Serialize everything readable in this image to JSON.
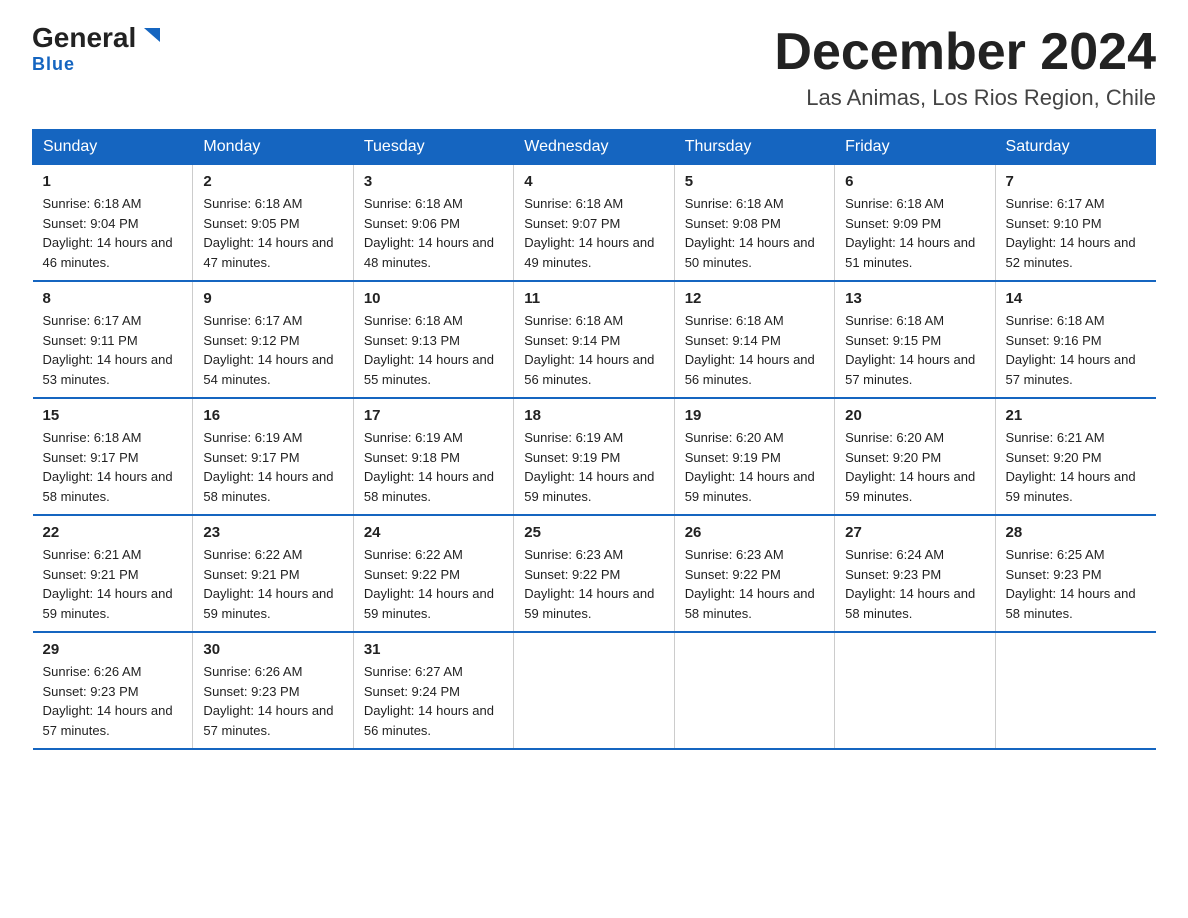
{
  "logo": {
    "general": "General",
    "blue": "Blue",
    "arrow": "▶"
  },
  "title": "December 2024",
  "subtitle": "Las Animas, Los Rios Region, Chile",
  "weekdays": [
    "Sunday",
    "Monday",
    "Tuesday",
    "Wednesday",
    "Thursday",
    "Friday",
    "Saturday"
  ],
  "weeks": [
    [
      {
        "day": "1",
        "sunrise": "6:18 AM",
        "sunset": "9:04 PM",
        "daylight": "14 hours and 46 minutes."
      },
      {
        "day": "2",
        "sunrise": "6:18 AM",
        "sunset": "9:05 PM",
        "daylight": "14 hours and 47 minutes."
      },
      {
        "day": "3",
        "sunrise": "6:18 AM",
        "sunset": "9:06 PM",
        "daylight": "14 hours and 48 minutes."
      },
      {
        "day": "4",
        "sunrise": "6:18 AM",
        "sunset": "9:07 PM",
        "daylight": "14 hours and 49 minutes."
      },
      {
        "day": "5",
        "sunrise": "6:18 AM",
        "sunset": "9:08 PM",
        "daylight": "14 hours and 50 minutes."
      },
      {
        "day": "6",
        "sunrise": "6:18 AM",
        "sunset": "9:09 PM",
        "daylight": "14 hours and 51 minutes."
      },
      {
        "day": "7",
        "sunrise": "6:17 AM",
        "sunset": "9:10 PM",
        "daylight": "14 hours and 52 minutes."
      }
    ],
    [
      {
        "day": "8",
        "sunrise": "6:17 AM",
        "sunset": "9:11 PM",
        "daylight": "14 hours and 53 minutes."
      },
      {
        "day": "9",
        "sunrise": "6:17 AM",
        "sunset": "9:12 PM",
        "daylight": "14 hours and 54 minutes."
      },
      {
        "day": "10",
        "sunrise": "6:18 AM",
        "sunset": "9:13 PM",
        "daylight": "14 hours and 55 minutes."
      },
      {
        "day": "11",
        "sunrise": "6:18 AM",
        "sunset": "9:14 PM",
        "daylight": "14 hours and 56 minutes."
      },
      {
        "day": "12",
        "sunrise": "6:18 AM",
        "sunset": "9:14 PM",
        "daylight": "14 hours and 56 minutes."
      },
      {
        "day": "13",
        "sunrise": "6:18 AM",
        "sunset": "9:15 PM",
        "daylight": "14 hours and 57 minutes."
      },
      {
        "day": "14",
        "sunrise": "6:18 AM",
        "sunset": "9:16 PM",
        "daylight": "14 hours and 57 minutes."
      }
    ],
    [
      {
        "day": "15",
        "sunrise": "6:18 AM",
        "sunset": "9:17 PM",
        "daylight": "14 hours and 58 minutes."
      },
      {
        "day": "16",
        "sunrise": "6:19 AM",
        "sunset": "9:17 PM",
        "daylight": "14 hours and 58 minutes."
      },
      {
        "day": "17",
        "sunrise": "6:19 AM",
        "sunset": "9:18 PM",
        "daylight": "14 hours and 58 minutes."
      },
      {
        "day": "18",
        "sunrise": "6:19 AM",
        "sunset": "9:19 PM",
        "daylight": "14 hours and 59 minutes."
      },
      {
        "day": "19",
        "sunrise": "6:20 AM",
        "sunset": "9:19 PM",
        "daylight": "14 hours and 59 minutes."
      },
      {
        "day": "20",
        "sunrise": "6:20 AM",
        "sunset": "9:20 PM",
        "daylight": "14 hours and 59 minutes."
      },
      {
        "day": "21",
        "sunrise": "6:21 AM",
        "sunset": "9:20 PM",
        "daylight": "14 hours and 59 minutes."
      }
    ],
    [
      {
        "day": "22",
        "sunrise": "6:21 AM",
        "sunset": "9:21 PM",
        "daylight": "14 hours and 59 minutes."
      },
      {
        "day": "23",
        "sunrise": "6:22 AM",
        "sunset": "9:21 PM",
        "daylight": "14 hours and 59 minutes."
      },
      {
        "day": "24",
        "sunrise": "6:22 AM",
        "sunset": "9:22 PM",
        "daylight": "14 hours and 59 minutes."
      },
      {
        "day": "25",
        "sunrise": "6:23 AM",
        "sunset": "9:22 PM",
        "daylight": "14 hours and 59 minutes."
      },
      {
        "day": "26",
        "sunrise": "6:23 AM",
        "sunset": "9:22 PM",
        "daylight": "14 hours and 58 minutes."
      },
      {
        "day": "27",
        "sunrise": "6:24 AM",
        "sunset": "9:23 PM",
        "daylight": "14 hours and 58 minutes."
      },
      {
        "day": "28",
        "sunrise": "6:25 AM",
        "sunset": "9:23 PM",
        "daylight": "14 hours and 58 minutes."
      }
    ],
    [
      {
        "day": "29",
        "sunrise": "6:26 AM",
        "sunset": "9:23 PM",
        "daylight": "14 hours and 57 minutes."
      },
      {
        "day": "30",
        "sunrise": "6:26 AM",
        "sunset": "9:23 PM",
        "daylight": "14 hours and 57 minutes."
      },
      {
        "day": "31",
        "sunrise": "6:27 AM",
        "sunset": "9:24 PM",
        "daylight": "14 hours and 56 minutes."
      },
      null,
      null,
      null,
      null
    ]
  ]
}
